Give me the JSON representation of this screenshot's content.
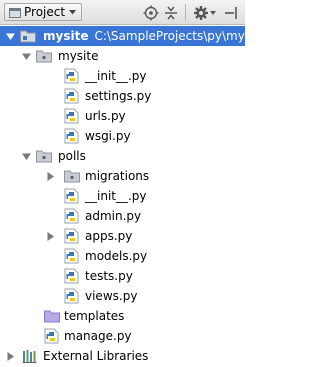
{
  "toolbar": {
    "view_label": "Project",
    "buttons": [
      "target-icon",
      "collapse-all-icon",
      "gear-icon",
      "hide-icon"
    ]
  },
  "tree": {
    "root": {
      "label": "mysite",
      "path": "C:\\SampleProjects\\py\\mysite"
    },
    "mysite_pkg": {
      "label": "mysite",
      "files": [
        "__init__.py",
        "settings.py",
        "urls.py",
        "wsgi.py"
      ]
    },
    "polls": {
      "label": "polls",
      "migrations": "migrations",
      "init": "__init__.py",
      "admin": "admin.py",
      "apps": "apps.py",
      "models": "models.py",
      "tests": "tests.py",
      "views": "views.py"
    },
    "templates": "templates",
    "manage": "manage.py",
    "external": "External Libraries"
  },
  "colors": {
    "selection": "#3875d7",
    "python_blue": "#3b77b5",
    "python_yellow": "#f5c518",
    "folder": "#c9ccd3",
    "templates_folder": "#b9a8e8"
  }
}
